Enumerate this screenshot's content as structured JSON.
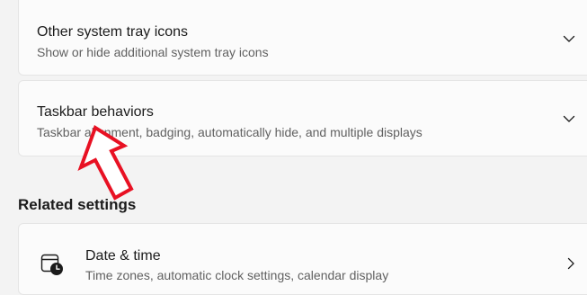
{
  "tray_card": {
    "title": "Other system tray icons",
    "description": "Show or hide additional system tray icons",
    "chevron_icon": "chevron-down-icon"
  },
  "taskbar_card": {
    "title": "Taskbar behaviors",
    "description": "Taskbar alignment, badging, automatically hide, and multiple displays",
    "chevron_icon": "chevron-down-icon"
  },
  "related": {
    "header": "Related settings"
  },
  "date_card": {
    "title": "Date & time",
    "description": "Time zones, automatic clock settings, calendar display",
    "icon": "calendar-clock-icon",
    "chevron_icon": "chevron-right-icon"
  },
  "annotation": {
    "arrow_color": "#e81123"
  }
}
